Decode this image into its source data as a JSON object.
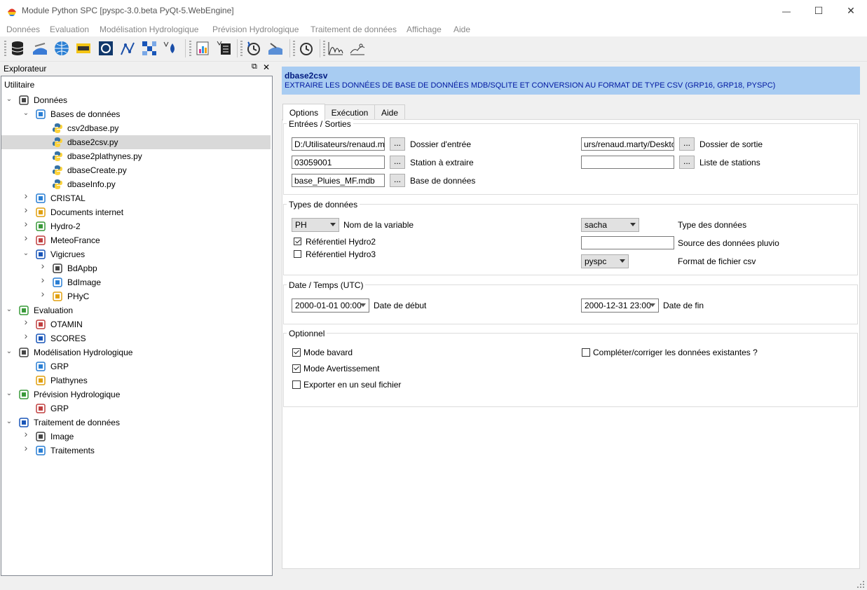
{
  "window": {
    "title": "Module Python SPC [pyspc-3.0.beta PyQt-5.WebEngine]",
    "minimize": "—",
    "maximize": "☐",
    "close": "✕"
  },
  "menu": [
    "Données",
    "Evaluation",
    "Modélisation Hydrologique",
    "Prévision Hydrologique",
    "Traitement de données",
    "Affichage",
    "Aide"
  ],
  "dock": {
    "title": "Explorateur",
    "float_glyph": "⧉",
    "close_glyph": "✕"
  },
  "tree": {
    "root": "Utilitaire",
    "items": [
      {
        "label": "Données",
        "level": 0,
        "expanded": true
      },
      {
        "label": "Bases de données",
        "level": 1,
        "expanded": true
      },
      {
        "label": "csv2dbase.py",
        "level": 2
      },
      {
        "label": "dbase2csv.py",
        "level": 2,
        "selected": true
      },
      {
        "label": "dbase2plathynes.py",
        "level": 2
      },
      {
        "label": "dbaseCreate.py",
        "level": 2
      },
      {
        "label": "dbaseInfo.py",
        "level": 2
      },
      {
        "label": "CRISTAL",
        "level": 1,
        "expanded": false
      },
      {
        "label": "Documents internet",
        "level": 1,
        "expanded": false
      },
      {
        "label": "Hydro-2",
        "level": 1,
        "expanded": false
      },
      {
        "label": "MeteoFrance",
        "level": 1,
        "expanded": false
      },
      {
        "label": "Vigicrues",
        "level": 1,
        "expanded": true
      },
      {
        "label": "BdApbp",
        "level": 2,
        "expanded": false
      },
      {
        "label": "BdImage",
        "level": 2,
        "expanded": false
      },
      {
        "label": "PHyC",
        "level": 2,
        "expanded": false
      },
      {
        "label": "Evaluation",
        "level": 0,
        "expanded": true
      },
      {
        "label": "OTAMIN",
        "level": 1,
        "expanded": false
      },
      {
        "label": "SCORES",
        "level": 1,
        "expanded": false
      },
      {
        "label": "Modélisation Hydrologique",
        "level": 0,
        "expanded": true
      },
      {
        "label": "GRP",
        "level": 1
      },
      {
        "label": "Plathynes",
        "level": 1
      },
      {
        "label": "Prévision Hydrologique",
        "level": 0,
        "expanded": true
      },
      {
        "label": "GRP",
        "level": 1
      },
      {
        "label": "Traitement de données",
        "level": 0,
        "expanded": true
      },
      {
        "label": "Image",
        "level": 1,
        "expanded": false
      },
      {
        "label": "Traitements",
        "level": 1,
        "expanded": false
      }
    ]
  },
  "banner": {
    "title": "dbase2csv",
    "description": "EXTRAIRE LES DONNÉES DE BASE DE DONNÉES MDB/SQLITE ET CONVERSION AU FORMAT DE TYPE CSV (GRP16, GRP18, PYSPC)"
  },
  "tabs": [
    "Options",
    "Exécution",
    "Aide"
  ],
  "io": {
    "title": "Entrées / Sorties",
    "input_dir_value": "D:/Utilisateurs/renaud.marty",
    "input_dir_label": "Dossier d'entrée",
    "output_dir_value": "urs/renaud.marty/Desktop",
    "output_dir_label": "Dossier de sortie",
    "station_value": "03059001",
    "station_label": "Station à extraire",
    "station_list_value": "",
    "station_list_label": "Liste de stations",
    "db_value": "base_Pluies_MF.mdb",
    "db_label": "Base de données",
    "browse": "..."
  },
  "types": {
    "title": "Types de données",
    "variable_value": "PH",
    "variable_label": "Nom de la variable",
    "hydro2_label": "Référentiel Hydro2",
    "hydro2_checked": true,
    "hydro3_label": "Référentiel Hydro3",
    "hydro3_checked": false,
    "datatype_value": "sacha",
    "datatype_label": "Type des données",
    "source_value": "",
    "source_label": "Source des données pluvio",
    "format_value": "pyspc",
    "format_label": "Format de fichier csv"
  },
  "dates": {
    "title": "Date / Temps (UTC)",
    "start_value": "2000-01-01 00:00",
    "start_label": "Date de début",
    "end_value": "2000-12-31 23:00",
    "end_label": "Date de fin"
  },
  "optional": {
    "title": "Optionnel",
    "verbose_label": "Mode bavard",
    "verbose_checked": true,
    "warning_label": "Mode Avertissement",
    "warning_checked": true,
    "single_file_label": "Exporter en un seul fichier",
    "single_file_checked": false,
    "complete_label": "Compléter/corriger les données existantes ?",
    "complete_checked": false
  },
  "colors": {
    "banner": "#a8ccf2",
    "banner_text": "#001a80",
    "selection": "#d9d9d9"
  }
}
